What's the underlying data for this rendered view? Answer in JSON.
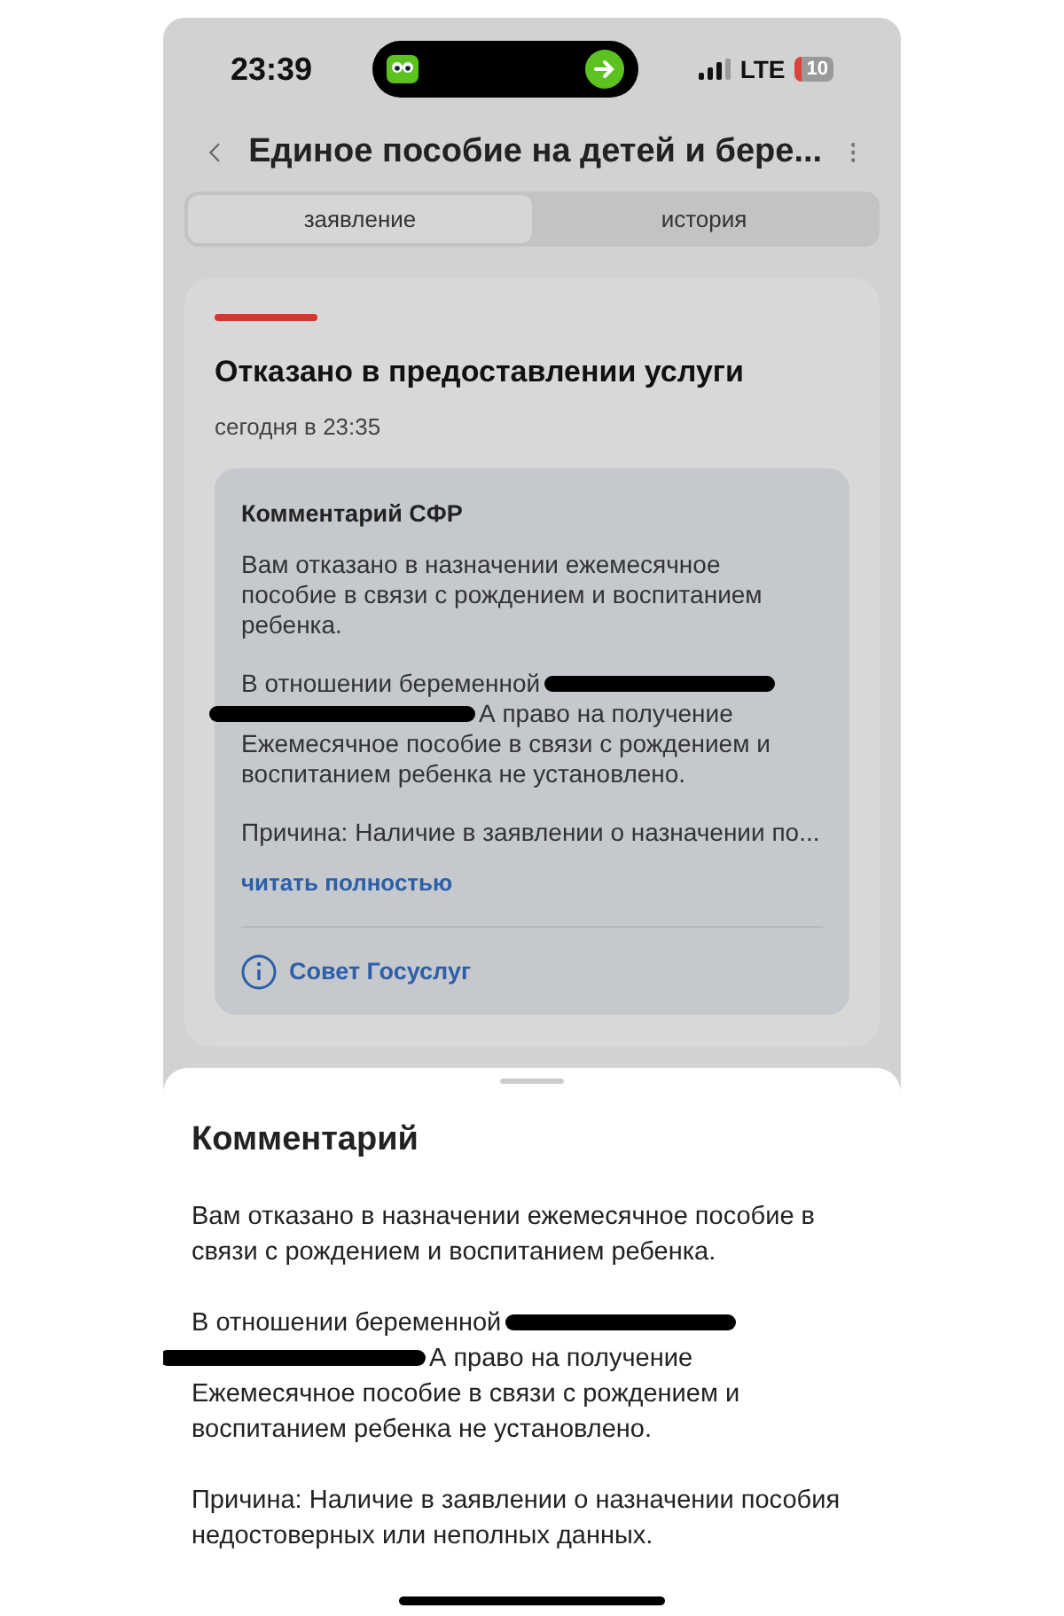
{
  "status_bar": {
    "time": "23:39",
    "network": "LTE",
    "battery": "10"
  },
  "header": {
    "title": "Единое пособие на детей и бере..."
  },
  "tabs": [
    {
      "label": "заявление",
      "selected": true
    },
    {
      "label": "история",
      "selected": false
    }
  ],
  "status_card": {
    "title": "Отказано в предоставлении услуги",
    "date": "сегодня в 23:35",
    "comment": {
      "title": "Комментарий СФР",
      "paragraphs": [
        {
          "kind": "text",
          "text": "Вам отказано в назначении ежемесячное пособие в связи с рождением и воспитанием ребенка."
        },
        {
          "kind": "redacted",
          "before": "В отношении беременной",
          "after": "А право на получение",
          "rest": "Ежемесячное пособие в связи с рождением и воспитанием ребенка не установлено."
        },
        {
          "kind": "truncated",
          "text": "Причина: Наличие в заявлении о назначении по..."
        }
      ],
      "link": "читать полностью",
      "tip": "Совет Госуслуг"
    }
  },
  "sheet": {
    "title": "Комментарий",
    "paragraphs": [
      {
        "kind": "text",
        "text": "Вам отказано в назначении ежемесячное пособие в связи с рождением и воспитанием ребенка."
      },
      {
        "kind": "redacted",
        "before": "В отношении беременной",
        "after": "А право на получение",
        "rest": "Ежемесячное пособие в связи с рождением и воспитанием ребенка не установлено."
      },
      {
        "kind": "text",
        "text": "Причина: Наличие в заявлении о назначении пособия недостоверных или неполных данных."
      }
    ]
  }
}
